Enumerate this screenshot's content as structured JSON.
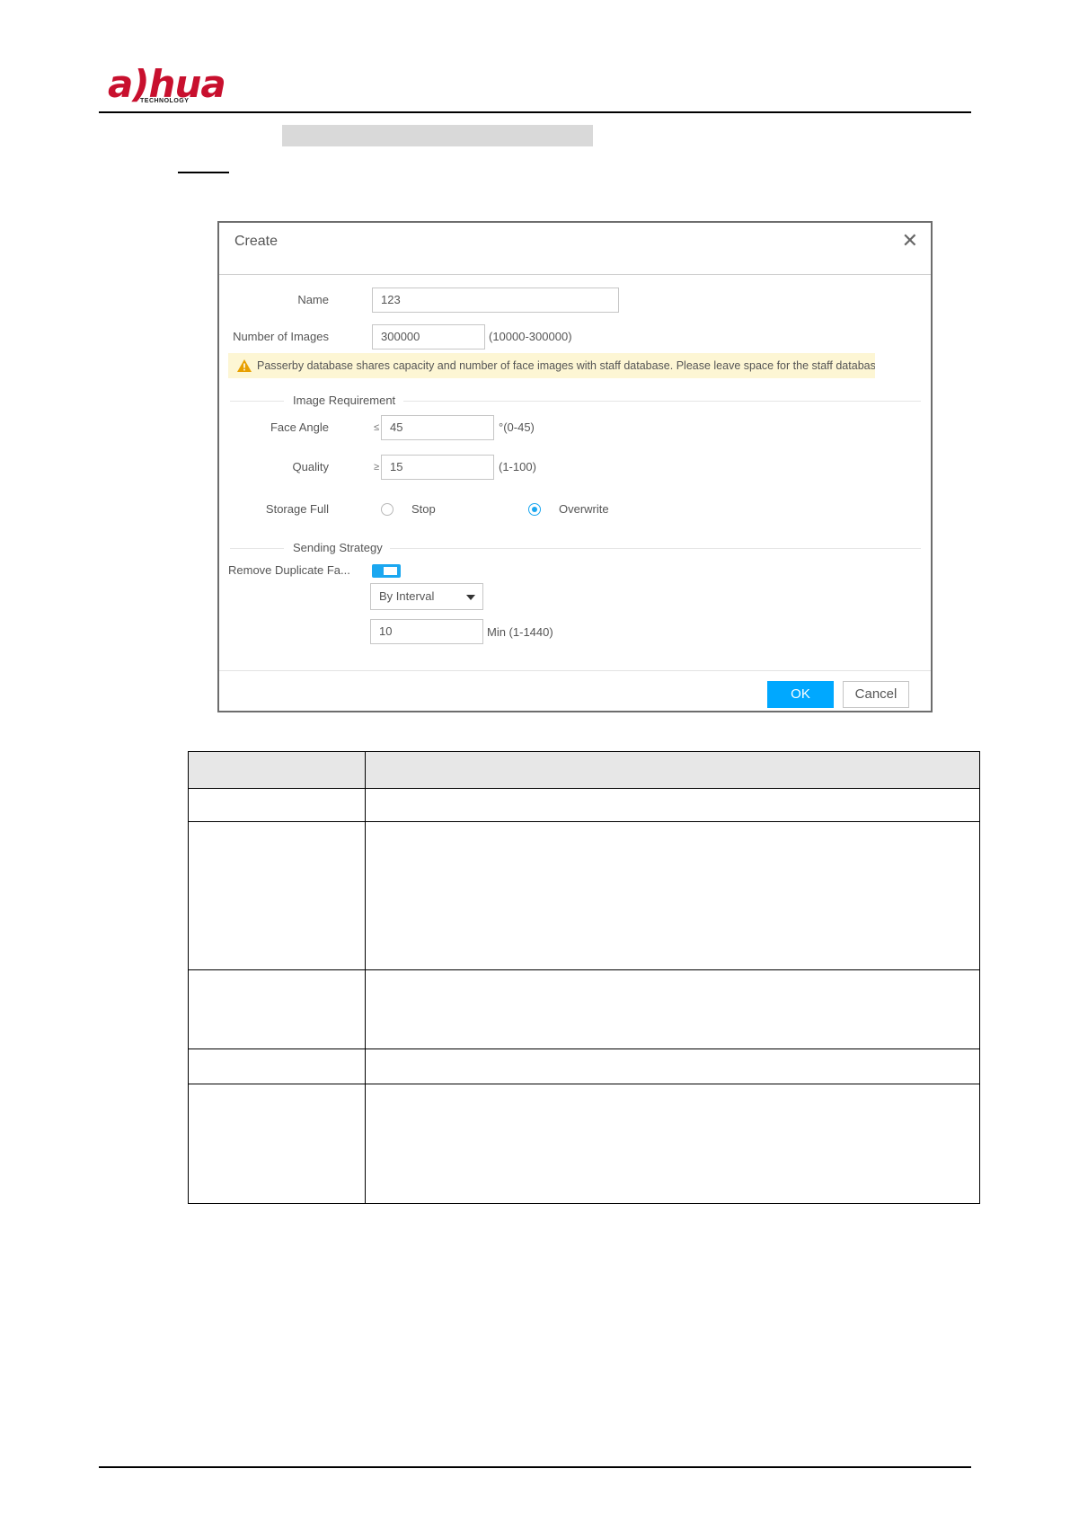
{
  "header": {
    "logo_text": "a)hua",
    "logo_sub": "TECHNOLOGY"
  },
  "dialog": {
    "title": "Create",
    "close_glyph": "✕",
    "fields": {
      "name_label": "Name",
      "name_value": "123",
      "images_label": "Number of Images",
      "images_value": "300000",
      "images_range": "(10000-300000)"
    },
    "warning": {
      "text": "Passerby database shares capacity and number of face images with staff database. Please leave space for the staff database.",
      "color": "#e8a000"
    },
    "image_requirement": {
      "section_title": "Image Requirement",
      "face_angle_label": "Face Angle",
      "face_angle_op": "≤",
      "face_angle_value": "45",
      "face_angle_range": "°(0-45)",
      "quality_label": "Quality",
      "quality_op": "≥",
      "quality_value": "15",
      "quality_range": "(1-100)",
      "storage_full_label": "Storage Full",
      "option_stop": "Stop",
      "option_overwrite": "Overwrite",
      "selected": "Overwrite"
    },
    "sending_strategy": {
      "section_title": "Sending Strategy",
      "remove_duplicate_label": "Remove Duplicate Fa...",
      "remove_duplicate_enabled": true,
      "mode_selected": "By Interval",
      "interval_value": "10",
      "interval_range": "Min (1-1440)"
    },
    "buttons": {
      "ok": "OK",
      "cancel": "Cancel"
    },
    "accent_color": "#00a8ff"
  },
  "table": {
    "rows": [
      {
        "c1": "",
        "c2": ""
      },
      {
        "c1": "",
        "c2": ""
      },
      {
        "c1": "",
        "c2": ""
      },
      {
        "c1": "",
        "c2": ""
      },
      {
        "c1": "",
        "c2": ""
      }
    ]
  }
}
